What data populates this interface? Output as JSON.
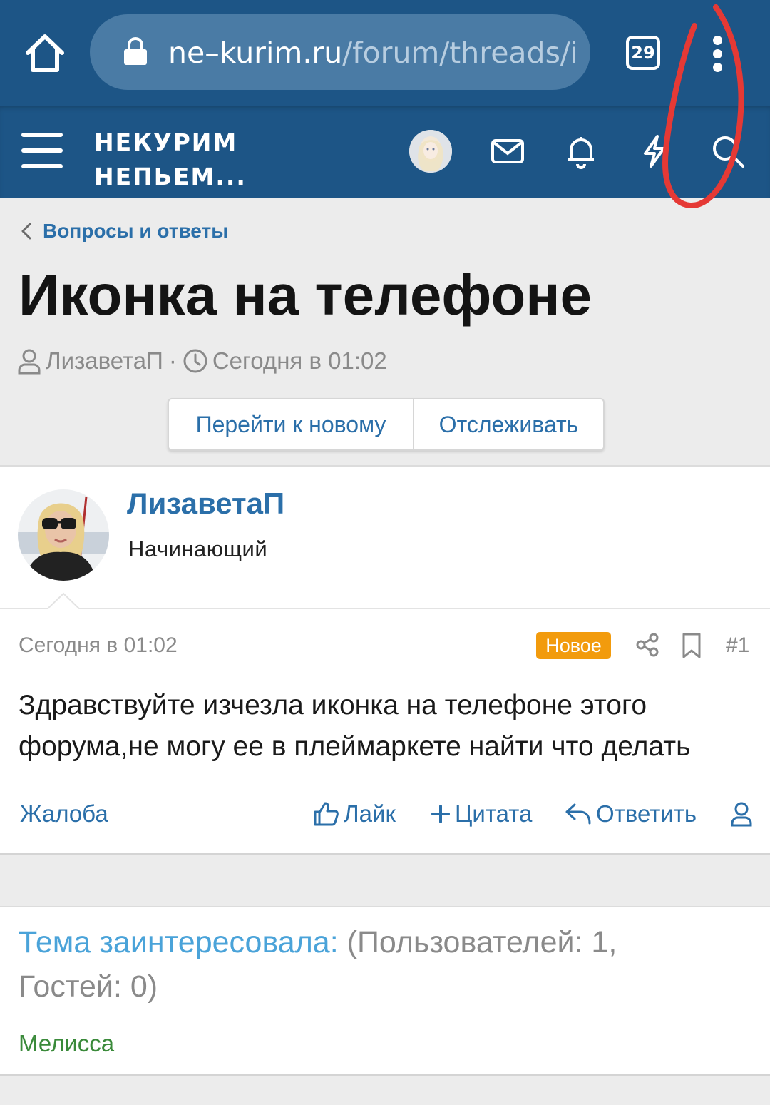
{
  "browser": {
    "url_host": "ne–kurim.ru",
    "url_path": "/forum/threads/ik",
    "tab_count": "29"
  },
  "header": {
    "logo_line1": "НЕКУРИМ",
    "logo_line2": "НЕПЬЕМ..."
  },
  "breadcrumb": {
    "label": "Вопросы и ответы"
  },
  "thread": {
    "title": "Иконка на телефоне",
    "author": "ЛизаветаП",
    "separator": "·",
    "time": "Сегодня в 01:02",
    "btn_new": "Перейти к новому",
    "btn_watch": "Отслеживать"
  },
  "post": {
    "username": "ЛизаветаП",
    "user_title": "Начинающий",
    "date": "Сегодня в 01:02",
    "badge": "Новое",
    "number": "#1",
    "body": "Здравствуйте изчезла иконка на телефоне этого форума,не могу ее в плеймаркете найти что делать",
    "actions": {
      "report": "Жалоба",
      "like": "Лайк",
      "quote": "Цитата",
      "reply": "Ответить"
    }
  },
  "readers": {
    "label": "Тема заинтересовала:",
    "counts": "(Пользователей: 1, Гостей: 0)",
    "users": [
      "Мелисса"
    ]
  },
  "colors": {
    "header_bg": "#1d5586",
    "link": "#2b6fa9",
    "badge": "#f29b0d",
    "annotation": "#e53935"
  },
  "icons": [
    "home-icon",
    "lock-icon",
    "tabs-icon",
    "more-vert-icon",
    "menu-icon",
    "mail-icon",
    "bell-icon",
    "bolt-icon",
    "search-icon",
    "chevron-left-icon",
    "user-icon",
    "clock-icon",
    "share-icon",
    "bookmark-icon",
    "thumbs-up-icon",
    "plus-icon",
    "reply-icon"
  ]
}
